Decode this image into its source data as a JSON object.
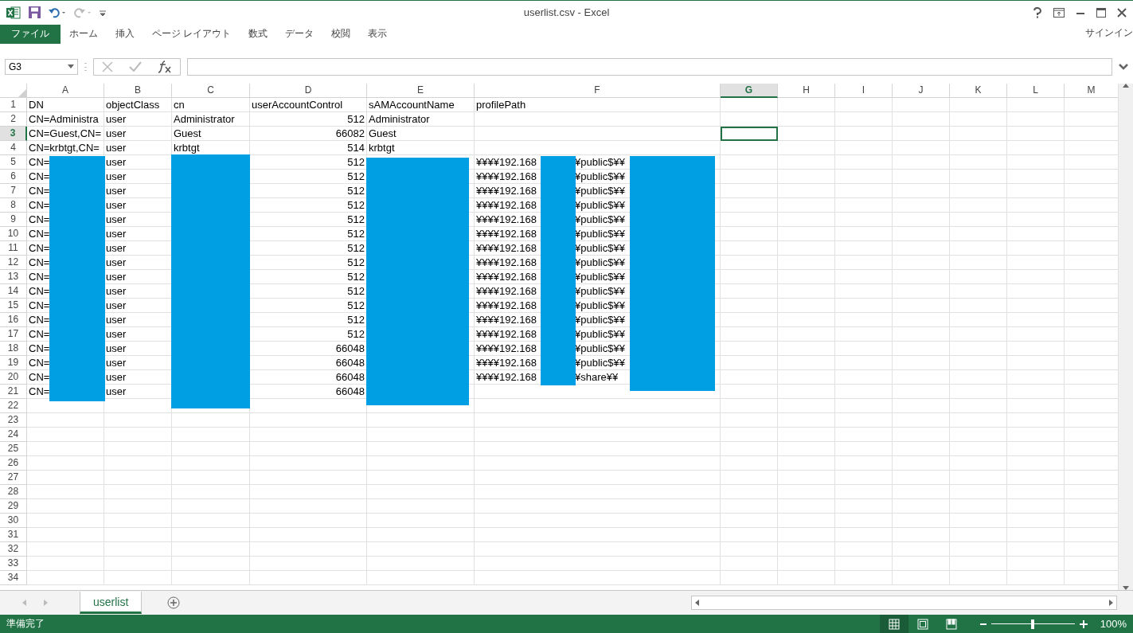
{
  "window": {
    "title": "userlist.csv - Excel"
  },
  "ribbon_tabs": [
    {
      "label": "ファイル",
      "kind": "file"
    },
    {
      "label": "ホーム",
      "kind": "tab"
    },
    {
      "label": "挿入",
      "kind": "tab"
    },
    {
      "label": "ページ レイアウト",
      "kind": "tab"
    },
    {
      "label": "数式",
      "kind": "tab"
    },
    {
      "label": "データ",
      "kind": "tab"
    },
    {
      "label": "校閲",
      "kind": "tab"
    },
    {
      "label": "表示",
      "kind": "tab"
    }
  ],
  "account": "サインイン",
  "formula_bar": {
    "name_box": "G3"
  },
  "sheet": {
    "columns": [
      {
        "label": "A",
        "selected": false
      },
      {
        "label": "B",
        "selected": false
      },
      {
        "label": "C",
        "selected": false
      },
      {
        "label": "D",
        "selected": false
      },
      {
        "label": "E",
        "selected": false
      },
      {
        "label": "F",
        "selected": false
      },
      {
        "label": "G",
        "selected": true
      },
      {
        "label": "H",
        "selected": false
      },
      {
        "label": "I",
        "selected": false
      },
      {
        "label": "J",
        "selected": false
      },
      {
        "label": "K",
        "selected": false
      },
      {
        "label": "L",
        "selected": false
      },
      {
        "label": "M",
        "selected": false
      }
    ],
    "rows": [
      {
        "header": "1",
        "selected": false,
        "cells": {
          "a": {
            "kind": "text",
            "text": "DN"
          },
          "b": {
            "kind": "text",
            "text": "objectClass"
          },
          "c": {
            "kind": "text",
            "text": "cn"
          },
          "d": {
            "kind": "text",
            "text": "userAccountControl"
          },
          "e": {
            "kind": "text",
            "text": "sAMAccountName"
          },
          "f": {
            "kind": "text",
            "text": "profilePath"
          }
        }
      },
      {
        "header": "2",
        "selected": false,
        "cells": {
          "a": {
            "kind": "text",
            "text": "CN=Administra"
          },
          "b": {
            "kind": "text",
            "text": "user"
          },
          "c": {
            "kind": "text",
            "text": "Administrator"
          },
          "d": {
            "kind": "number",
            "text": "512"
          },
          "e": {
            "kind": "text",
            "text": "Administrator"
          }
        }
      },
      {
        "header": "3",
        "selected": true,
        "cells": {
          "a": {
            "kind": "text",
            "text": "CN=Guest,CN="
          },
          "b": {
            "kind": "text",
            "text": "user"
          },
          "c": {
            "kind": "text",
            "text": "Guest"
          },
          "d": {
            "kind": "number",
            "text": "66082"
          },
          "e": {
            "kind": "text",
            "text": "Guest"
          }
        }
      },
      {
        "header": "4",
        "selected": false,
        "cells": {
          "a": {
            "kind": "text",
            "text": "CN=krbtgt,CN="
          },
          "b": {
            "kind": "text",
            "text": "user"
          },
          "c": {
            "kind": "text",
            "text": "krbtgt"
          },
          "d": {
            "kind": "number",
            "text": "514"
          },
          "e": {
            "kind": "text",
            "text": "krbtgt"
          }
        }
      },
      {
        "header": "5",
        "selected": false,
        "cells": {
          "a": {
            "kind": "text",
            "text": "CN="
          },
          "b": {
            "kind": "text",
            "text": "user"
          },
          "d": {
            "kind": "number",
            "text": "512"
          },
          "f": {
            "kind": "split",
            "parts": [
              "¥¥¥¥192.168",
              "¥public$¥¥"
            ]
          }
        }
      },
      {
        "header": "6",
        "selected": false,
        "cells": {
          "a": {
            "kind": "text",
            "text": "CN="
          },
          "b": {
            "kind": "text",
            "text": "user"
          },
          "d": {
            "kind": "number",
            "text": "512"
          },
          "f": {
            "kind": "split",
            "parts": [
              "¥¥¥¥192.168",
              "¥public$¥¥"
            ]
          }
        }
      },
      {
        "header": "7",
        "selected": false,
        "cells": {
          "a": {
            "kind": "text",
            "text": "CN="
          },
          "b": {
            "kind": "text",
            "text": "user"
          },
          "d": {
            "kind": "number",
            "text": "512"
          },
          "f": {
            "kind": "split",
            "parts": [
              "¥¥¥¥192.168",
              "¥public$¥¥"
            ]
          }
        }
      },
      {
        "header": "8",
        "selected": false,
        "cells": {
          "a": {
            "kind": "text",
            "text": "CN="
          },
          "b": {
            "kind": "text",
            "text": "user"
          },
          "d": {
            "kind": "number",
            "text": "512"
          },
          "f": {
            "kind": "split",
            "parts": [
              "¥¥¥¥192.168",
              "¥public$¥¥"
            ]
          }
        }
      },
      {
        "header": "9",
        "selected": false,
        "cells": {
          "a": {
            "kind": "text",
            "text": "CN="
          },
          "b": {
            "kind": "text",
            "text": "user"
          },
          "d": {
            "kind": "number",
            "text": "512"
          },
          "f": {
            "kind": "split",
            "parts": [
              "¥¥¥¥192.168",
              "¥public$¥¥"
            ]
          }
        }
      },
      {
        "header": "10",
        "selected": false,
        "cells": {
          "a": {
            "kind": "text",
            "text": "CN="
          },
          "b": {
            "kind": "text",
            "text": "user"
          },
          "d": {
            "kind": "number",
            "text": "512"
          },
          "f": {
            "kind": "split",
            "parts": [
              "¥¥¥¥192.168",
              "¥public$¥¥"
            ]
          }
        }
      },
      {
        "header": "11",
        "selected": false,
        "cells": {
          "a": {
            "kind": "text",
            "text": "CN="
          },
          "b": {
            "kind": "text",
            "text": "user"
          },
          "d": {
            "kind": "number",
            "text": "512"
          },
          "f": {
            "kind": "split",
            "parts": [
              "¥¥¥¥192.168",
              "¥public$¥¥"
            ]
          }
        }
      },
      {
        "header": "12",
        "selected": false,
        "cells": {
          "a": {
            "kind": "text",
            "text": "CN="
          },
          "b": {
            "kind": "text",
            "text": "user"
          },
          "d": {
            "kind": "number",
            "text": "512"
          },
          "f": {
            "kind": "split",
            "parts": [
              "¥¥¥¥192.168",
              "¥public$¥¥"
            ]
          }
        }
      },
      {
        "header": "13",
        "selected": false,
        "cells": {
          "a": {
            "kind": "text",
            "text": "CN="
          },
          "b": {
            "kind": "text",
            "text": "user"
          },
          "d": {
            "kind": "number",
            "text": "512"
          },
          "f": {
            "kind": "split",
            "parts": [
              "¥¥¥¥192.168",
              "¥public$¥¥"
            ]
          }
        }
      },
      {
        "header": "14",
        "selected": false,
        "cells": {
          "a": {
            "kind": "text",
            "text": "CN="
          },
          "b": {
            "kind": "text",
            "text": "user"
          },
          "d": {
            "kind": "number",
            "text": "512"
          },
          "f": {
            "kind": "split",
            "parts": [
              "¥¥¥¥192.168",
              "¥public$¥¥"
            ]
          }
        }
      },
      {
        "header": "15",
        "selected": false,
        "cells": {
          "a": {
            "kind": "text",
            "text": "CN="
          },
          "b": {
            "kind": "text",
            "text": "user"
          },
          "d": {
            "kind": "number",
            "text": "512"
          },
          "f": {
            "kind": "split",
            "parts": [
              "¥¥¥¥192.168",
              "¥public$¥¥"
            ]
          }
        }
      },
      {
        "header": "16",
        "selected": false,
        "cells": {
          "a": {
            "kind": "text",
            "text": "CN="
          },
          "b": {
            "kind": "text",
            "text": "user"
          },
          "d": {
            "kind": "number",
            "text": "512"
          },
          "f": {
            "kind": "split",
            "parts": [
              "¥¥¥¥192.168",
              "¥public$¥¥"
            ]
          }
        }
      },
      {
        "header": "17",
        "selected": false,
        "cells": {
          "a": {
            "kind": "text",
            "text": "CN="
          },
          "b": {
            "kind": "text",
            "text": "user"
          },
          "d": {
            "kind": "number",
            "text": "512"
          },
          "f": {
            "kind": "split",
            "parts": [
              "¥¥¥¥192.168",
              "¥public$¥¥"
            ]
          }
        }
      },
      {
        "header": "18",
        "selected": false,
        "cells": {
          "a": {
            "kind": "text",
            "text": "CN="
          },
          "b": {
            "kind": "text",
            "text": "user"
          },
          "d": {
            "kind": "number",
            "text": "66048"
          },
          "f": {
            "kind": "split",
            "parts": [
              "¥¥¥¥192.168",
              "¥public$¥¥"
            ]
          }
        }
      },
      {
        "header": "19",
        "selected": false,
        "cells": {
          "a": {
            "kind": "text",
            "text": "CN="
          },
          "b": {
            "kind": "text",
            "text": "user"
          },
          "d": {
            "kind": "number",
            "text": "66048"
          },
          "f": {
            "kind": "split",
            "parts": [
              "¥¥¥¥192.168",
              "¥public$¥¥"
            ]
          }
        }
      },
      {
        "header": "20",
        "selected": false,
        "cells": {
          "a": {
            "kind": "text",
            "text": "CN="
          },
          "b": {
            "kind": "text",
            "text": "user"
          },
          "d": {
            "kind": "number",
            "text": "66048"
          },
          "f": {
            "kind": "split",
            "parts": [
              "¥¥¥¥192.168",
              "¥share¥¥"
            ]
          }
        }
      },
      {
        "header": "21",
        "selected": false,
        "cells": {
          "a": {
            "kind": "text",
            "text": "CN="
          },
          "b": {
            "kind": "text",
            "text": "user"
          },
          "d": {
            "kind": "number",
            "text": "66048"
          }
        }
      },
      {
        "header": "22",
        "selected": false
      },
      {
        "header": "23",
        "selected": false
      },
      {
        "header": "24",
        "selected": false
      },
      {
        "header": "25",
        "selected": false
      },
      {
        "header": "26",
        "selected": false
      },
      {
        "header": "27",
        "selected": false
      },
      {
        "header": "28",
        "selected": false
      },
      {
        "header": "29",
        "selected": false
      },
      {
        "header": "30",
        "selected": false
      },
      {
        "header": "31",
        "selected": false
      },
      {
        "header": "32",
        "selected": false
      },
      {
        "header": "33",
        "selected": false
      },
      {
        "header": "34",
        "selected": false
      }
    ]
  },
  "sheet_tabs": [
    {
      "label": "userlist",
      "selected": true
    }
  ],
  "status_bar": {
    "text": "準備完了",
    "views": [
      {
        "kind": "normal",
        "selected": true
      },
      {
        "kind": "page_layout",
        "selected": false
      },
      {
        "kind": "page_break",
        "selected": false
      }
    ],
    "zoom": {
      "level": 0.5,
      "reading": "100%"
    }
  }
}
